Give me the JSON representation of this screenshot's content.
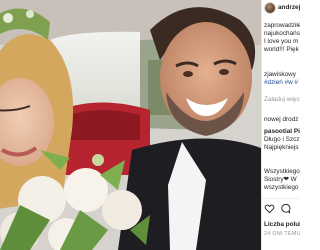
{
  "post": {
    "author": "andrzejpiase",
    "caption_lines": [
      "zaprowadziłe",
      "najukochańs",
      "I love you m",
      "world!!! Pięk",
      "zjawiskowy",
      "#dzień #w #"
    ],
    "add_comment_placeholder": "Załaduj więce",
    "comment_lines": [
      "nowej drodz",
      "pasootial Pi",
      "Długo i Szcz",
      "Najpiękniejs",
      "Wszystkiego",
      "Siostry❤ W",
      "wszystkiego"
    ],
    "likes_label": "Liczba polub",
    "date_label": "24 DNI TEMU"
  },
  "icons": {
    "like": "heart-icon",
    "comment": "comment-icon"
  },
  "colors": {
    "text": "#262626",
    "muted": "#9a9a9a",
    "hashtag": "#1a4d8f",
    "car_seat_red": "#b5242f"
  }
}
